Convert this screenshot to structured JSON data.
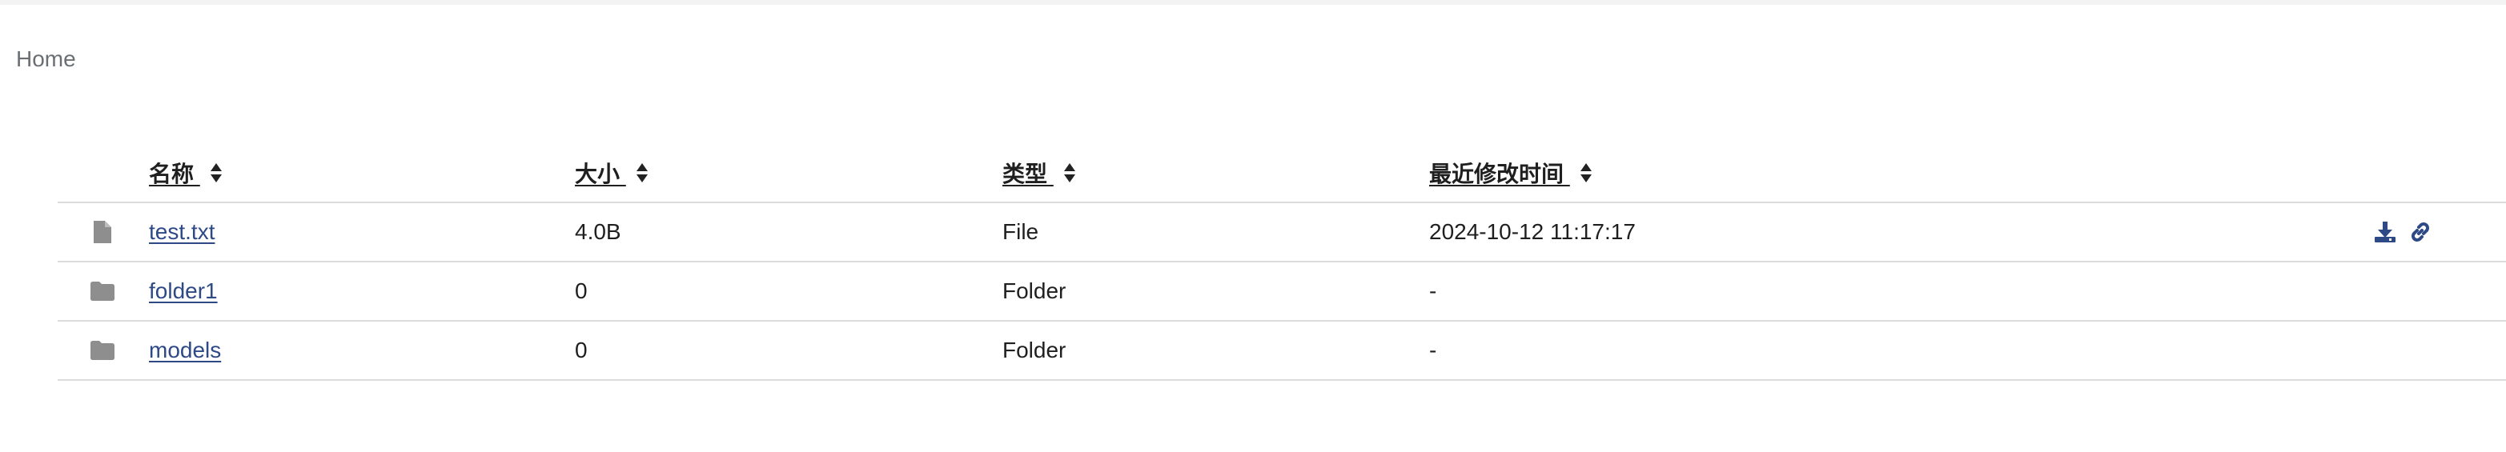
{
  "breadcrumb": {
    "home": "Home"
  },
  "table": {
    "headers": {
      "name": "名称 ",
      "size": "大小 ",
      "type": "类型 ",
      "modified": "最近修改时间 "
    },
    "rows": [
      {
        "icon": "file-icon",
        "name": "test.txt",
        "size": "4.0B",
        "type": "File",
        "modified": "2024-10-12 11:17:17",
        "actions": [
          "download-icon",
          "link-icon"
        ]
      },
      {
        "icon": "folder-icon",
        "name": "folder1",
        "size": "0",
        "type": "Folder",
        "modified": "-"
      },
      {
        "icon": "folder-icon",
        "name": "models",
        "size": "0",
        "type": "Folder",
        "modified": "-"
      }
    ]
  },
  "colors": {
    "link": "#2e4a86",
    "icon_gray": "#8e8e8e",
    "divider": "#dcdcdc",
    "breadcrumb": "#6b6f73"
  }
}
